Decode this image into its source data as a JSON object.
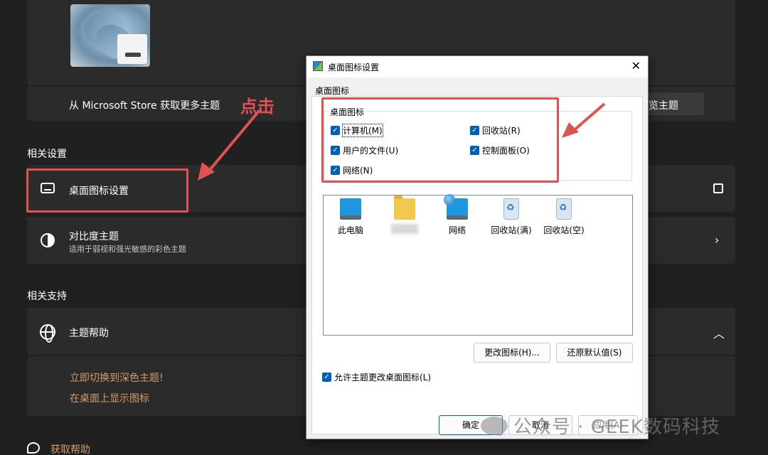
{
  "settings": {
    "store_label": "从 Microsoft Store 获取更多主题",
    "browse_label": "浏览主题",
    "related_settings_title": "相关设置",
    "desktop_icon_settings_label": "桌面图标设置",
    "contrast_title": "对比度主题",
    "contrast_subtitle": "适用于弱视和强光敏感的彩色主题",
    "related_support_title": "相关支持",
    "theme_help_label": "主题帮助",
    "link_dark_theme": "立即切换到深色主题!",
    "link_show_icons": "在桌面上显示图标",
    "get_help_label": "获取帮助"
  },
  "annotation": {
    "click_text": "点击",
    "color": "#e05252"
  },
  "dialog": {
    "title": "桌面图标设置",
    "close": "✕",
    "tab": "桌面图标",
    "group_title": "桌面图标",
    "checkboxes": [
      {
        "label": "计算机(M)",
        "checked": true
      },
      {
        "label": "回收站(R)",
        "checked": true
      },
      {
        "label": "用户的文件(U)",
        "checked": true
      },
      {
        "label": "控制面板(O)",
        "checked": true
      },
      {
        "label": "网络(N)",
        "checked": true
      }
    ],
    "icons": [
      {
        "label": "此电脑",
        "icon": "computer-icon"
      },
      {
        "label": "",
        "icon": "folder-icon"
      },
      {
        "label": "网络",
        "icon": "network-icon"
      },
      {
        "label": "回收站(满)",
        "icon": "recycle-bin-full-icon"
      },
      {
        "label": "回收站(空)",
        "icon": "recycle-bin-empty-icon"
      }
    ],
    "change_icon_label": "更改图标(H)...",
    "restore_default_label": "还原默认值(S)",
    "allow_theme_label": "允许主题更改桌面图标(L)",
    "ok_label": "确定",
    "cancel_label": "取消",
    "apply_label": "应用(A)"
  },
  "watermark": "公众号 · GEEK数码科技"
}
